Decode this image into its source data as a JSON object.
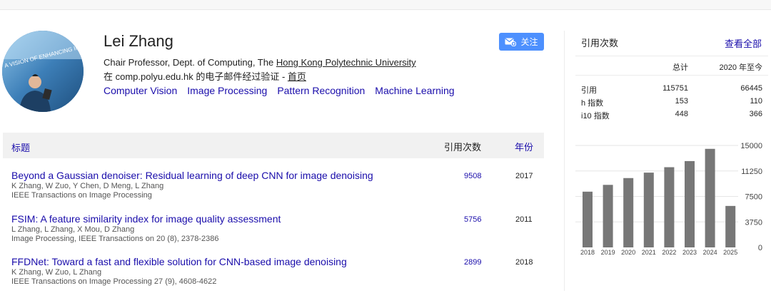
{
  "profile": {
    "name": "Lei Zhang",
    "affiliation_prefix": "Chair Professor, Dept. of Computing, The ",
    "affiliation_link": "Hong Kong Polytechnic University",
    "email_text": "在 comp.polyu.edu.hk 的电子邮件经过验证 - ",
    "homepage_link": "首页",
    "interests": [
      "Computer Vision",
      "Image Processing",
      "Pattern Recognition",
      "Machine Learning"
    ],
    "follow_label": "关注",
    "avatar_banner_text": "A VISION OF ENHANCING IMAG"
  },
  "table": {
    "col_title": "标题",
    "col_cites": "引用次数",
    "col_year": "年份",
    "rows": [
      {
        "title": "Beyond a Gaussian denoiser: Residual learning of deep CNN for image denoising",
        "authors": "K Zhang, W Zuo, Y Chen, D Meng, L Zhang",
        "venue": "IEEE Transactions on Image Processing",
        "cites": "9508",
        "year": "2017"
      },
      {
        "title": "FSIM: A feature similarity index for image quality assessment",
        "authors": "L Zhang, L Zhang, X Mou, D Zhang",
        "venue": "Image Processing, IEEE Transactions on 20 (8), 2378-2386",
        "cites": "5756",
        "year": "2011"
      },
      {
        "title": "FFDNet: Toward a fast and flexible solution for CNN-based image denoising",
        "authors": "K Zhang, W Zuo, L Zhang",
        "venue": "IEEE Transactions on Image Processing 27 (9), 4608-4622",
        "cites": "2899",
        "year": "2018"
      }
    ]
  },
  "sidebar": {
    "title": "引用次数",
    "view_all": "查看全部",
    "col_total": "总计",
    "col_since": "2020 年至今",
    "stats": [
      {
        "label": "引用",
        "total": "115751",
        "since": "66445"
      },
      {
        "label": "h 指数",
        "total": "153",
        "since": "110"
      },
      {
        "label": "i10 指数",
        "total": "448",
        "since": "366"
      }
    ]
  },
  "colors": {
    "link": "#1a0dab",
    "follow_button": "#4d90fe",
    "bar": "#777777"
  },
  "icons": {
    "follow": "envelope-plus-icon"
  },
  "chart_data": {
    "type": "bar",
    "categories": [
      "2018",
      "2019",
      "2020",
      "2021",
      "2022",
      "2023",
      "2024",
      "2025"
    ],
    "values": [
      8200,
      9200,
      10200,
      11000,
      11800,
      12700,
      14500,
      6100
    ],
    "yticks": [
      0,
      3750,
      7500,
      11250,
      15000
    ],
    "ylim": [
      0,
      15000
    ],
    "grid": true
  }
}
